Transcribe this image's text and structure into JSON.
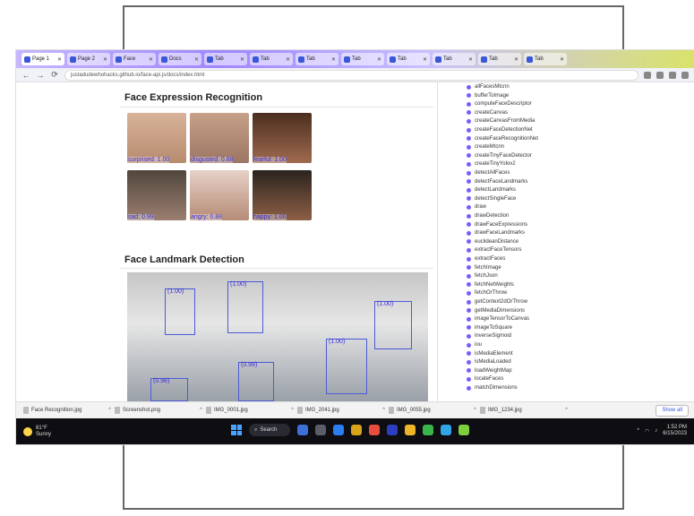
{
  "browser": {
    "tabs": [
      {
        "title": "Page 1"
      },
      {
        "title": "Page 2"
      },
      {
        "title": "Face"
      },
      {
        "title": "Docs"
      },
      {
        "title": "Tab"
      },
      {
        "title": "Tab"
      },
      {
        "title": "Tab"
      },
      {
        "title": "Tab"
      },
      {
        "title": "Tab"
      },
      {
        "title": "Tab"
      },
      {
        "title": "Tab"
      },
      {
        "title": "Tab"
      }
    ],
    "address": "justadudewhohacks.github.io/face-api.js/docs/index.html",
    "nav": {
      "back": "←",
      "forward": "→",
      "reload": "⟳"
    }
  },
  "page": {
    "sections": {
      "expression_title": "Face Expression Recognition",
      "landmark_title": "Face Landmark Detection"
    },
    "expression_faces": [
      {
        "label": "surprised: 1.00"
      },
      {
        "label": "disgusted: 0.88"
      },
      {
        "label": "fearful: 1.00"
      },
      {
        "label": "sad: 0.99"
      },
      {
        "label": "angry: 0.88"
      },
      {
        "label": "happy: 1.00"
      }
    ],
    "landmark_boxes": [
      {
        "conf": "(1.00)"
      },
      {
        "conf": "(1.00)"
      },
      {
        "conf": "(1.00)"
      },
      {
        "conf": "(1.00)"
      },
      {
        "conf": "(0.99)"
      },
      {
        "conf": "(0.98)"
      }
    ]
  },
  "sidebar": {
    "items": [
      "allFacesMtcnn",
      "bufferToImage",
      "computeFaceDescriptor",
      "createCanvas",
      "createCanvasFromMedia",
      "createFaceDetectionNet",
      "createFaceRecognitionNet",
      "createMtcnn",
      "createTinyFaceDetector",
      "createTinyYolov2",
      "detectAllFaces",
      "detectFaceLandmarks",
      "detectLandmarks",
      "detectSingleFace",
      "draw",
      "drawDetection",
      "drawFaceExpressions",
      "drawFaceLandmarks",
      "euclideanDistance",
      "extractFaceTensors",
      "extractFaces",
      "fetchImage",
      "fetchJson",
      "fetchNetWeights",
      "fetchOrThrow",
      "getContext2dOrThrow",
      "getMediaDimensions",
      "imageTensorToCanvas",
      "imageToSquare",
      "inverseSigmoid",
      "iou",
      "isMediaElement",
      "isMediaLoaded",
      "loadWeightMap",
      "locateFaces",
      "matchDimensions"
    ]
  },
  "downloads": {
    "items": [
      "Face Recognition.jpg",
      "Screenshot.png",
      "IMG_0001.jpg",
      "IMG_2041.jpg",
      "IMG_0055.jpg",
      "IMG_1234.jpg"
    ],
    "show_all": "Show all"
  },
  "taskbar": {
    "weather_temp": "81°F",
    "weather_desc": "Sunny",
    "search_label": "Search",
    "time": "1:52 PM",
    "date": "6/15/2023"
  },
  "colors": {
    "accent": "#3b2dd6",
    "box": "#4b5bd8",
    "sidebar_dot": "#7b5cff",
    "taskbar": "#0d0d12"
  }
}
